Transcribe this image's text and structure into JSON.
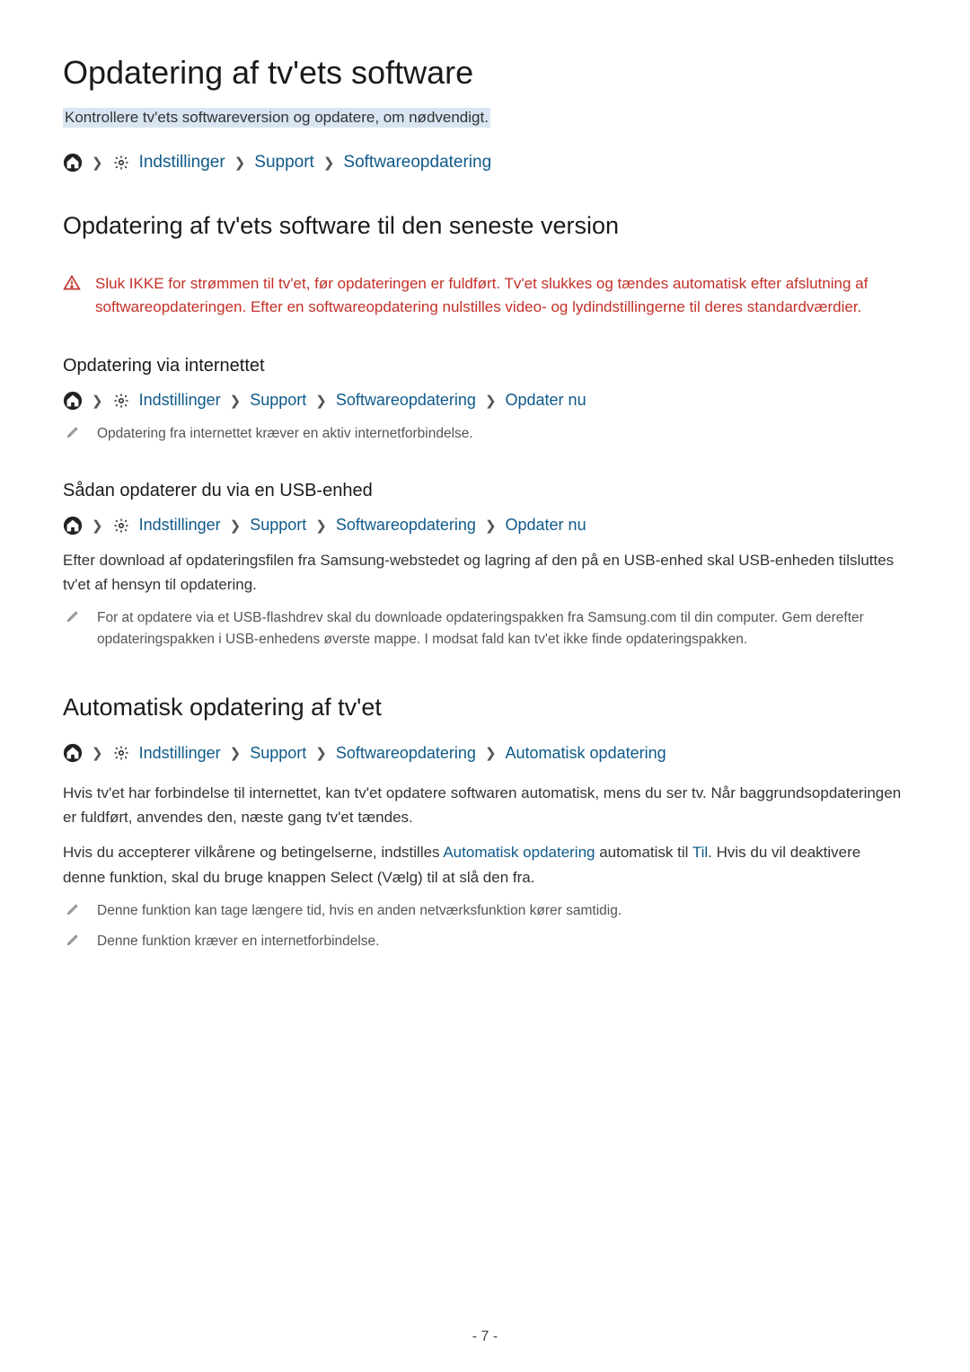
{
  "title": "Opdatering af tv'ets software",
  "subtitle": "Kontrollere tv'ets softwareversion og opdatere, om nødvendigt.",
  "breadcrumb_main": {
    "settings": "Indstillinger",
    "support": "Support",
    "software_update": "Softwareopdatering"
  },
  "section1": {
    "heading": "Opdatering af tv'ets software til den seneste version",
    "warning": "Sluk IKKE for strømmen til tv'et, før opdateringen er fuldført. Tv'et slukkes og tændes automatisk efter afslutning af softwareopdateringen. Efter en softwareopdatering nulstilles video- og lydindstillingerne til deres standardværdier."
  },
  "section2": {
    "heading": "Opdatering via internettet",
    "breadcrumb": {
      "settings": "Indstillinger",
      "support": "Support",
      "software_update": "Softwareopdatering",
      "update_now": "Opdater nu"
    },
    "note": "Opdatering fra internettet kræver en aktiv internetforbindelse."
  },
  "section3": {
    "heading": "Sådan opdaterer du via en USB-enhed",
    "breadcrumb": {
      "settings": "Indstillinger",
      "support": "Support",
      "software_update": "Softwareopdatering",
      "update_now": "Opdater nu"
    },
    "body": "Efter download af opdateringsfilen fra Samsung-webstedet og lagring af den på en USB-enhed skal USB-enheden tilsluttes tv'et af hensyn til opdatering.",
    "note": "For at opdatere via et USB-flashdrev skal du downloade opdateringspakken fra Samsung.com til din computer. Gem derefter opdateringspakken i USB-enhedens øverste mappe. I modsat fald kan tv'et ikke finde opdateringspakken."
  },
  "section4": {
    "heading": "Automatisk opdatering af tv'et",
    "breadcrumb": {
      "settings": "Indstillinger",
      "support": "Support",
      "software_update": "Softwareopdatering",
      "auto_update": "Automatisk opdatering"
    },
    "body1": "Hvis tv'et har forbindelse til internettet, kan tv'et opdatere softwaren automatisk, mens du ser tv. Når baggrundsopdateringen er fuldført, anvendes den, næste gang tv'et tændes.",
    "body2_pre": "Hvis du accepterer vilkårene og betingelserne, indstilles ",
    "body2_link1": "Automatisk opdatering",
    "body2_mid": " automatisk til ",
    "body2_link2": "Til",
    "body2_post": ". Hvis du vil deaktivere denne funktion, skal du bruge knappen Select (Vælg) til at slå den fra.",
    "note1": "Denne funktion kan tage længere tid, hvis en anden netværksfunktion kører samtidig.",
    "note2": "Denne funktion kræver en internetforbindelse."
  },
  "page_number": "- 7 -"
}
